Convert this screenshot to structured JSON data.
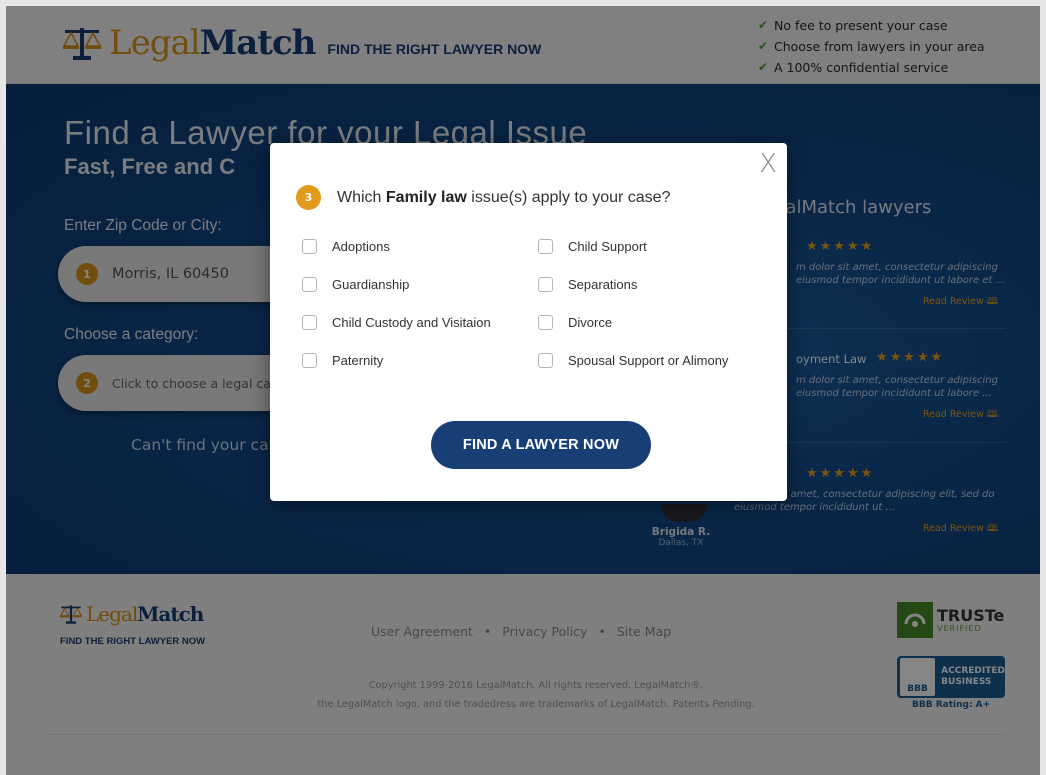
{
  "brand": {
    "logo_legal": "Legal",
    "logo_match": "Match",
    "tagline": "FIND THE RIGHT LAWYER NOW",
    "color_gold": "#d8941c",
    "color_navy": "#173f75"
  },
  "header": {
    "benefits": [
      "No fee to present your case",
      "Choose from lawyers in your area",
      "A 100% confidential service"
    ]
  },
  "hero": {
    "title": "Find a Lawyer for your Legal Issue",
    "subtitle": "Fast, Free and C",
    "zip_label": "Enter Zip Code or City:",
    "zip_step": "1",
    "zip_value": "Morris, IL 60450",
    "category_label": "Choose a category:",
    "category_step": "2",
    "category_placeholder": "Click to choose a legal ca",
    "cant_find": "Can't find your ca"
  },
  "reviews": {
    "title": "galMatch lawyers",
    "items": [
      {
        "category": "",
        "stars": "★★★★★",
        "text": "m dolor sit amet, consectetur adipiscing eiusmod tempor incididunt ut labore et ...",
        "read": "Read Review"
      },
      {
        "category": "oyment Law",
        "stars": "★★★★★",
        "text": "m dolor sit amet, consectetur adipiscing eiusmod tempor incididunt ut labore ...",
        "read": "Read Review"
      },
      {
        "category": "",
        "stars": "★★★★★",
        "text": "m dolor sit amet, consectetur adipiscing elit, sed do eiusmod tempor incididunt ut ...",
        "read": "Read Review"
      }
    ],
    "reviewer_name": "Brigida R.",
    "reviewer_city": "Dallas, TX"
  },
  "modal": {
    "step": "3",
    "question_pre": "Which ",
    "question_bold": "Family law",
    "question_post": " issue(s) apply to your case?",
    "close": "X",
    "options_left": [
      "Adoptions",
      "Guardianship",
      "Child Custody and Visitaion",
      "Paternity"
    ],
    "options_right": [
      "Child Support",
      "Separations",
      "Divorce",
      "Spousal Support or Alimony"
    ],
    "submit_label": "FIND A LAWYER NOW"
  },
  "footer": {
    "links": [
      "User Agreement",
      "Privacy Policy",
      "Site Map"
    ],
    "copyright_line1": "Copyright 1999-2016 LegalMatch. All rights reserved. LegalMatch®,",
    "copyright_line2": "the LegalMatch logo, and the tradedress are trademarks of LegalMatch. Patents Pending.",
    "truste_main": "TRUSTe",
    "truste_sub": "VERIFIED",
    "bbb_seal": "BBB",
    "bbb_line1": "ACCREDITED",
    "bbb_line2": "BUSINESS",
    "bbb_rating": "BBB Rating: A+"
  }
}
